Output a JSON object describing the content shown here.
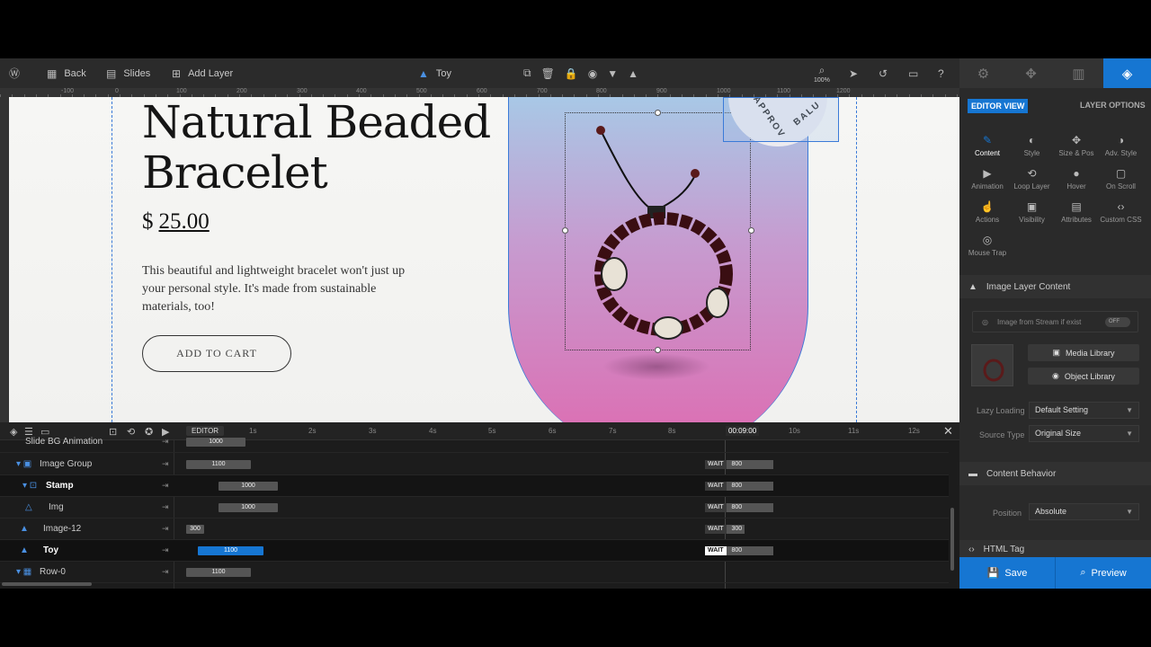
{
  "toolbar": {
    "back_label": "Back",
    "slides_label": "Slides",
    "add_layer_label": "Add Layer",
    "layer_name": "Toy",
    "zoom": "100%"
  },
  "ruler": {
    "labels": [
      "-100",
      "0",
      "100",
      "200",
      "300",
      "400",
      "500",
      "600",
      "700",
      "800",
      "900",
      "1000",
      "1100",
      "1200"
    ]
  },
  "slide": {
    "title_line1": "Natural Beaded",
    "title_line2": "Bracelet",
    "currency": "$",
    "price": "25.00",
    "description": "This beautiful and lightweight bracelet won't just up your personal style. It's made from sustainable materials, too!",
    "cart_button": "ADD TO CART",
    "stamp_text_left": "APPROV",
    "stamp_text_right": "BALU"
  },
  "timeline": {
    "editor_label": "EDITOR",
    "seconds": [
      "1s",
      "2s",
      "3s",
      "4s",
      "5s",
      "6s",
      "7s",
      "8s",
      "9s",
      "10s",
      "11s",
      "12s"
    ],
    "current_time": "00:09:00",
    "rows": [
      {
        "name": "Slide BG Animation",
        "bar": "1000",
        "wait": "",
        "end": ""
      },
      {
        "name": "Image Group",
        "bar": "1100",
        "wait": "WAIT",
        "end": "800"
      },
      {
        "name": "Stamp",
        "bar": "1000",
        "wait": "WAIT",
        "end": "800"
      },
      {
        "name": "Img",
        "bar": "1000",
        "wait": "WAIT",
        "end": "800"
      },
      {
        "name": "Image-12",
        "bar": "300",
        "wait": "WAIT",
        "end": "300"
      },
      {
        "name": "Toy",
        "bar": "1100",
        "wait": "WAIT",
        "end": "800"
      },
      {
        "name": "Row-0",
        "bar": "1100",
        "wait": "",
        "end": ""
      }
    ]
  },
  "panel": {
    "editor_view": "EDITOR VIEW",
    "layer_options": "LAYER OPTIONS",
    "options": [
      "Content",
      "Style",
      "Size & Pos",
      "Adv. Style",
      "Animation",
      "Loop Layer",
      "Hover",
      "On Scroll",
      "Actions",
      "Visibility",
      "Attributes",
      "Custom CSS",
      "Mouse Trap"
    ],
    "image_layer_content": "Image Layer Content",
    "stream_label": "Image from Stream if exist",
    "toggle_off": "OFF",
    "media_library": "Media Library",
    "object_library": "Object Library",
    "lazy_loading_label": "Lazy Loading",
    "lazy_loading_value": "Default Setting",
    "source_type_label": "Source Type",
    "source_type_value": "Original Size",
    "content_behavior": "Content Behavior",
    "position_label": "Position",
    "position_value": "Absolute",
    "html_tag": "HTML Tag",
    "save_label": "Save",
    "preview_label": "Preview"
  }
}
